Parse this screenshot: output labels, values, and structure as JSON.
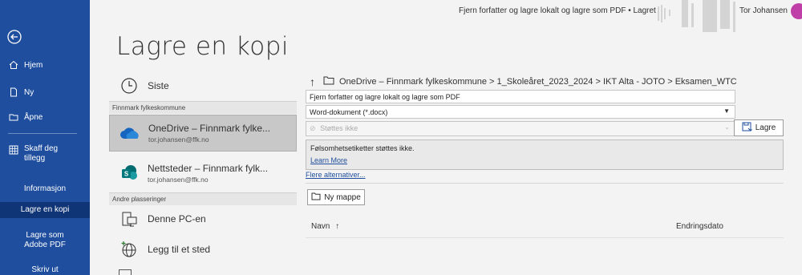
{
  "titlebar": {
    "document_title": "Fjern forfatter og lagre lokalt og lagre som PDF • Lagret",
    "user_name": "Tor Johansen"
  },
  "sidebar": {
    "items": [
      {
        "label": "Hjem",
        "icon": "home-icon"
      },
      {
        "label": "Ny",
        "icon": "new-document-icon"
      },
      {
        "label": "Åpne",
        "icon": "open-folder-icon"
      },
      {
        "label": "Skaff deg tillegg",
        "icon": "addins-icon"
      },
      {
        "label": "Informasjon"
      },
      {
        "label": "Lagre en kopi"
      },
      {
        "label": "Lagre som Adobe PDF"
      },
      {
        "label": "Skriv ut"
      }
    ]
  },
  "page_title": "Lagre en kopi",
  "locations": {
    "recent": {
      "label": "Siste",
      "icon": "clock-icon"
    },
    "group1_header": "Finnmark fylkeskommune",
    "onedrive": {
      "name": "OneDrive – Finnmark fylke...",
      "email": "tor.johansen@ffk.no",
      "icon": "onedrive-cloud-icon"
    },
    "sharepoint": {
      "name": "Nettsteder – Finnmark fylk...",
      "email": "tor.johansen@ffk.no",
      "icon": "sharepoint-icon"
    },
    "group2_header": "Andre plasseringer",
    "this_pc": {
      "label": "Denne PC-en",
      "icon": "computer-icon"
    },
    "add_place": {
      "label": "Legg til et sted",
      "icon": "globe-add-icon"
    }
  },
  "save_pane": {
    "path": "OneDrive – Finnmark fylkeskommune > 1_Skoleåret_2023_2024 > IKT Alta - JOTO > Eksamen_WTC",
    "filename": "Fjern forfatter og lagre lokalt og lagre som PDF",
    "file_type": "Word-dokument (*.docx)",
    "sensitivity_placeholder": "Støttes ikke",
    "save_label": "Lagre",
    "info_text": "Følsomhetsetiketter støttes ikke.",
    "learn_more": "Learn More",
    "more_options": "Flere alternativer...",
    "new_folder": "Ny mappe",
    "col_name": "Navn",
    "col_date": "Endringsdato"
  }
}
